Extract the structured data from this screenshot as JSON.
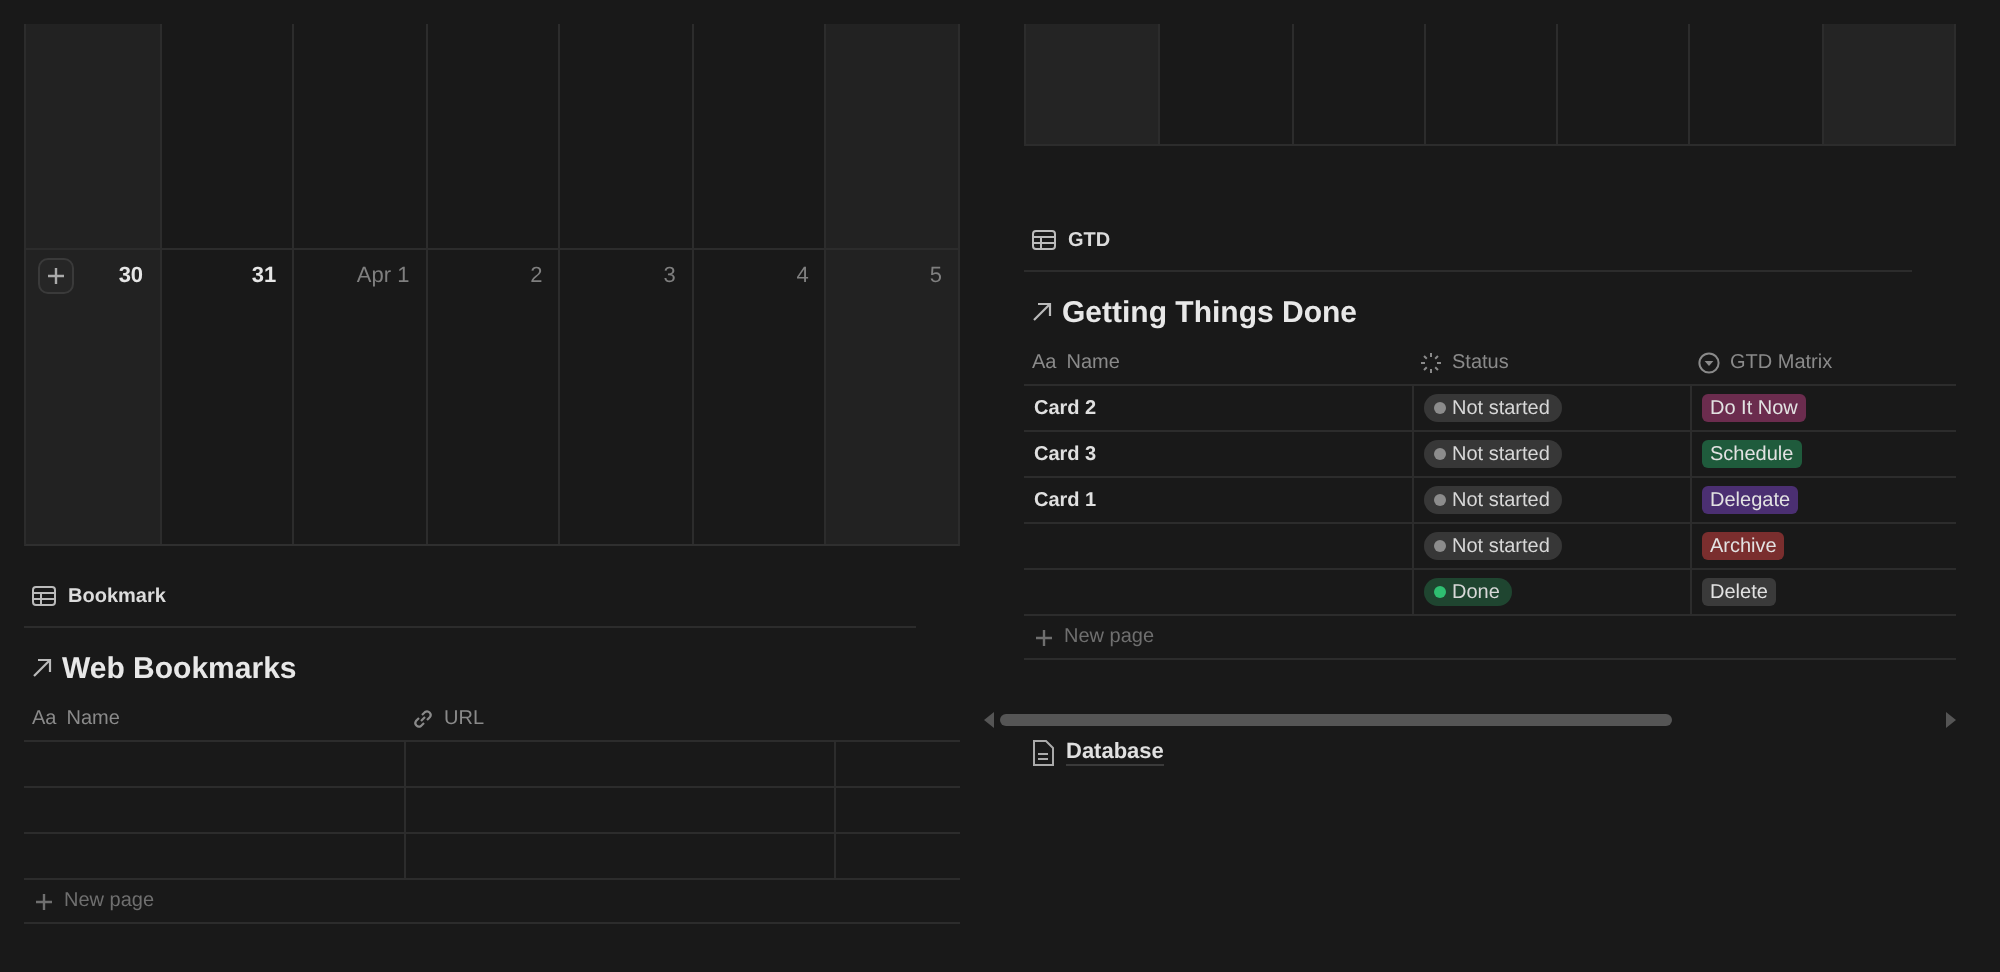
{
  "calendar_left": {
    "days": [
      {
        "label": "30",
        "dimmed": false,
        "weekend": true
      },
      {
        "label": "31",
        "dimmed": false,
        "weekend": false
      },
      {
        "label": "Apr 1",
        "dimmed": true,
        "weekend": false
      },
      {
        "label": "2",
        "dimmed": true,
        "weekend": false
      },
      {
        "label": "3",
        "dimmed": true,
        "weekend": false
      },
      {
        "label": "4",
        "dimmed": true,
        "weekend": false
      },
      {
        "label": "5",
        "dimmed": true,
        "weekend": true
      }
    ]
  },
  "bookmark": {
    "view_tab": "Bookmark",
    "title": "Web Bookmarks",
    "columns": [
      {
        "kind": "title",
        "icon_text": "Aa",
        "label": "Name"
      },
      {
        "kind": "url",
        "label": "URL"
      }
    ],
    "rows": [
      {
        "kind": "blank"
      },
      {
        "kind": "blank"
      },
      {
        "kind": "blank"
      }
    ],
    "new_page": "New page"
  },
  "calendar_right": {
    "cells": [
      {
        "kind": "weekend"
      },
      {
        "kind": "weekday"
      },
      {
        "kind": "weekday"
      },
      {
        "kind": "weekday"
      },
      {
        "kind": "weekday"
      },
      {
        "kind": "weekday"
      },
      {
        "kind": "weekend"
      }
    ]
  },
  "gtd": {
    "view_tab": "GTD",
    "title": "Getting Things Done",
    "columns": [
      {
        "kind": "title",
        "icon_text": "Aa",
        "label": "Name"
      },
      {
        "kind": "status",
        "label": "Status"
      },
      {
        "kind": "select",
        "label": "GTD Matrix"
      }
    ],
    "rows": [
      {
        "name": "Card 2",
        "status": {
          "label": "Not started",
          "color": "#8c8c8c"
        },
        "matrix": {
          "label": "Do It Now",
          "color": "#6b2c4e"
        }
      },
      {
        "name": "Card 3",
        "status": {
          "label": "Not started",
          "color": "#8c8c8c"
        },
        "matrix": {
          "label": "Schedule",
          "color": "#1f5b3c"
        }
      },
      {
        "name": "Card 1",
        "status": {
          "label": "Not started",
          "color": "#8c8c8c"
        },
        "matrix": {
          "label": "Delegate",
          "color": "#4b2f72"
        }
      },
      {
        "status": {
          "label": "Not started",
          "color": "#8c8c8c"
        },
        "matrix": {
          "label": "Archive",
          "color": "#7a2e2e"
        }
      },
      {
        "status": {
          "label": "Done",
          "color": "#2fbf71"
        },
        "matrix": {
          "label": "Delete",
          "color": "#3a3a3a"
        }
      }
    ],
    "new_page": "New page"
  },
  "page_link": {
    "label": "Database"
  }
}
